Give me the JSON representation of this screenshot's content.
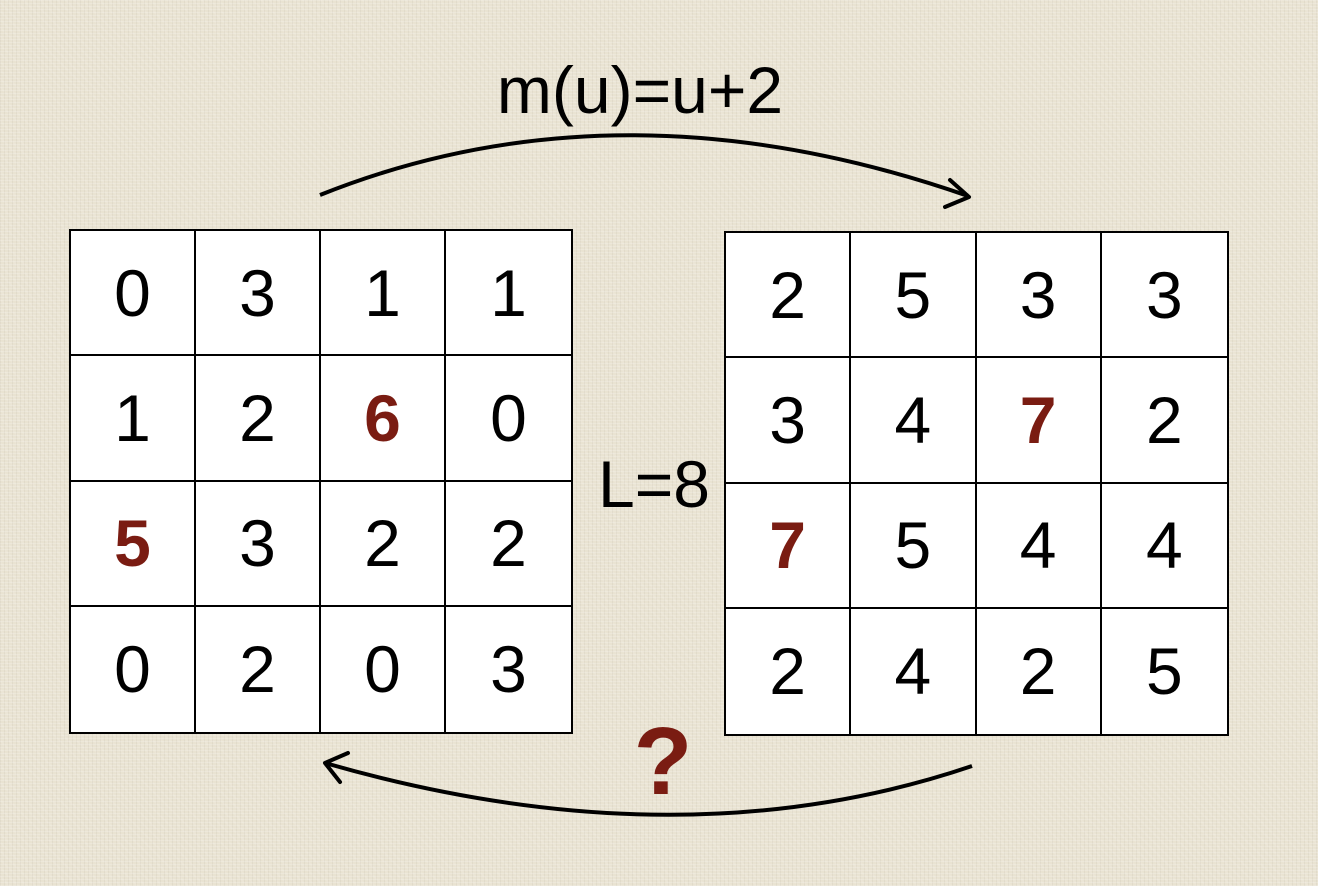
{
  "top_label": "m(u)=u+2",
  "middle_label": "L=8",
  "bottom_label": "?",
  "highlight_color": "#7a1c12",
  "left_grid": [
    [
      "0",
      "3",
      "1",
      "1"
    ],
    [
      "1",
      "2",
      "6",
      "0"
    ],
    [
      "5",
      "3",
      "2",
      "2"
    ],
    [
      "0",
      "2",
      "0",
      "3"
    ]
  ],
  "right_grid": [
    [
      "2",
      "5",
      "3",
      "3"
    ],
    [
      "3",
      "4",
      "7",
      "2"
    ],
    [
      "7",
      "5",
      "4",
      "4"
    ],
    [
      "2",
      "4",
      "2",
      "5"
    ]
  ],
  "highlighted_cells": [
    {
      "row": 1,
      "col": 2
    },
    {
      "row": 2,
      "col": 0
    }
  ]
}
